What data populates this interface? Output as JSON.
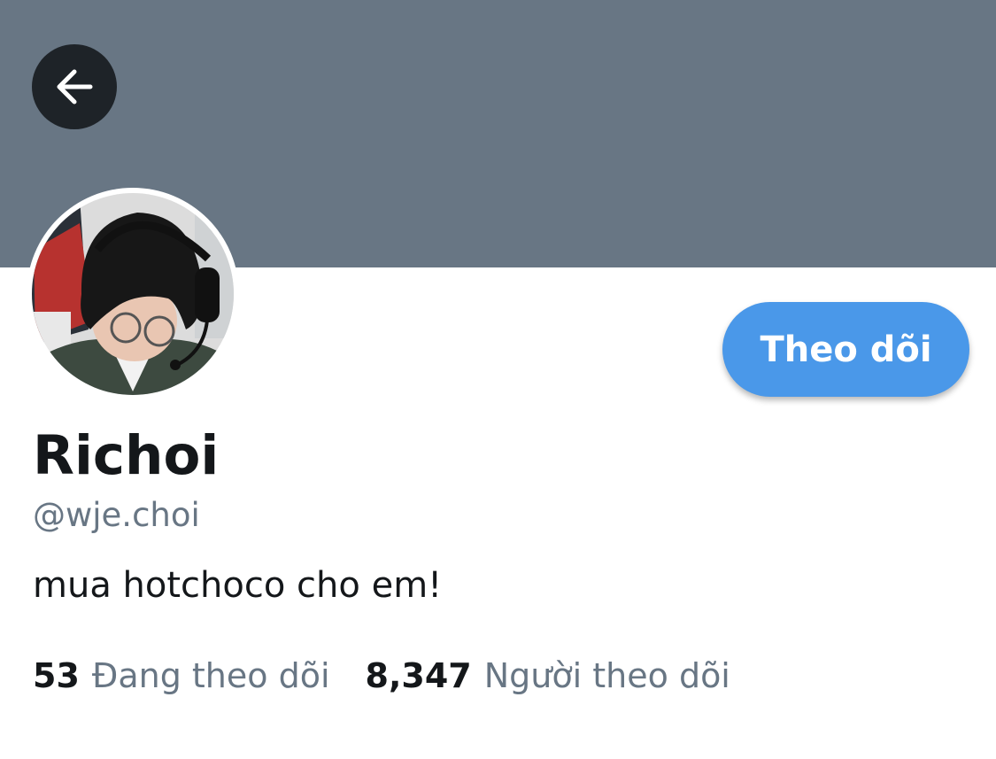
{
  "profile": {
    "display_name": "Richoi",
    "handle": "@wje.choi",
    "bio": "mua hotchoco cho em!",
    "follow_label": "Theo dõi",
    "stats": [
      {
        "count": "53",
        "label": "Đang theo dõi"
      },
      {
        "count": "8,347",
        "label": "Người theo dõi"
      }
    ]
  },
  "icons": {
    "back": "arrow-left-icon"
  },
  "colors": {
    "banner": "#687684",
    "accent": "#4a98e9",
    "text_primary": "#14171a",
    "text_secondary": "#687684",
    "back_button_bg": "#1e2328"
  }
}
